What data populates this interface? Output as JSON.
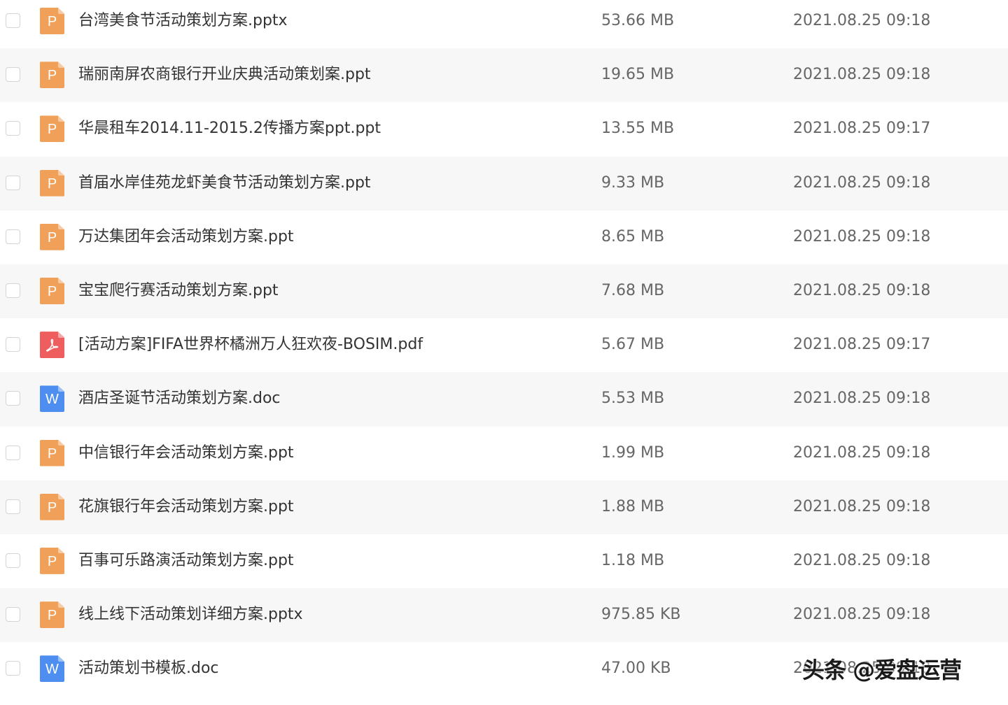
{
  "colors": {
    "ppt": "#f0a058",
    "pdf": "#ee5e5e",
    "doc": "#4d8ef0"
  },
  "icon_glyphs": {
    "ppt": "P",
    "doc": "W"
  },
  "files": [
    {
      "name": "台湾美食节活动策划方案.pptx",
      "size": "53.66 MB",
      "date": "2021.08.25 09:18",
      "type": "ppt",
      "icon": "powerpoint-file-icon"
    },
    {
      "name": "瑞丽南屏农商银行开业庆典活动策划案.ppt",
      "size": "19.65 MB",
      "date": "2021.08.25 09:18",
      "type": "ppt",
      "icon": "powerpoint-file-icon"
    },
    {
      "name": "华晨租车2014.11-2015.2传播方案ppt.ppt",
      "size": "13.55 MB",
      "date": "2021.08.25 09:17",
      "type": "ppt",
      "icon": "powerpoint-file-icon"
    },
    {
      "name": "首届水岸佳苑龙虾美食节活动策划方案.ppt",
      "size": "9.33 MB",
      "date": "2021.08.25 09:18",
      "type": "ppt",
      "icon": "powerpoint-file-icon"
    },
    {
      "name": "万达集团年会活动策划方案.ppt",
      "size": "8.65 MB",
      "date": "2021.08.25 09:18",
      "type": "ppt",
      "icon": "powerpoint-file-icon"
    },
    {
      "name": "宝宝爬行赛活动策划方案.ppt",
      "size": "7.68 MB",
      "date": "2021.08.25 09:18",
      "type": "ppt",
      "icon": "powerpoint-file-icon"
    },
    {
      "name": "[活动方案]FIFA世界杯橘洲万人狂欢夜-BOSIM.pdf",
      "size": "5.67 MB",
      "date": "2021.08.25 09:17",
      "type": "pdf",
      "icon": "pdf-file-icon"
    },
    {
      "name": "酒店圣诞节活动策划方案.doc",
      "size": "5.53 MB",
      "date": "2021.08.25 09:18",
      "type": "doc",
      "icon": "word-file-icon"
    },
    {
      "name": "中信银行年会活动策划方案.ppt",
      "size": "1.99 MB",
      "date": "2021.08.25 09:18",
      "type": "ppt",
      "icon": "powerpoint-file-icon"
    },
    {
      "name": "花旗银行年会活动策划方案.ppt",
      "size": "1.88 MB",
      "date": "2021.08.25 09:18",
      "type": "ppt",
      "icon": "powerpoint-file-icon"
    },
    {
      "name": "百事可乐路演活动策划方案.ppt",
      "size": "1.18 MB",
      "date": "2021.08.25 09:18",
      "type": "ppt",
      "icon": "powerpoint-file-icon"
    },
    {
      "name": "线上线下活动策划详细方案.pptx",
      "size": "975.85 KB",
      "date": "2021.08.25 09:18",
      "type": "ppt",
      "icon": "powerpoint-file-icon"
    },
    {
      "name": "活动策划书模板.doc",
      "size": "47.00 KB",
      "date": "2021.08.25 09:18",
      "type": "doc",
      "icon": "word-file-icon"
    }
  ],
  "watermark": "头条 @爱盘运营"
}
